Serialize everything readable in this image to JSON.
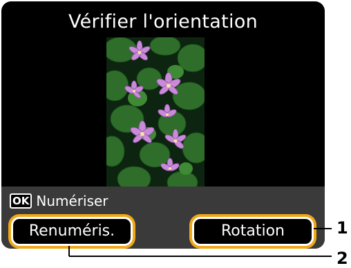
{
  "screen": {
    "title": "Vérifier l'orientation",
    "hint": {
      "key_label": "OK",
      "text": "Numériser"
    },
    "buttons": {
      "left_label": "Renuméris.",
      "right_label": "Rotation"
    }
  },
  "callouts": {
    "label_1": "1",
    "label_2": "2"
  },
  "colors": {
    "highlight": "#f0a818",
    "screen_bg": "#000000",
    "bar_bg": "#3a3a3a"
  }
}
